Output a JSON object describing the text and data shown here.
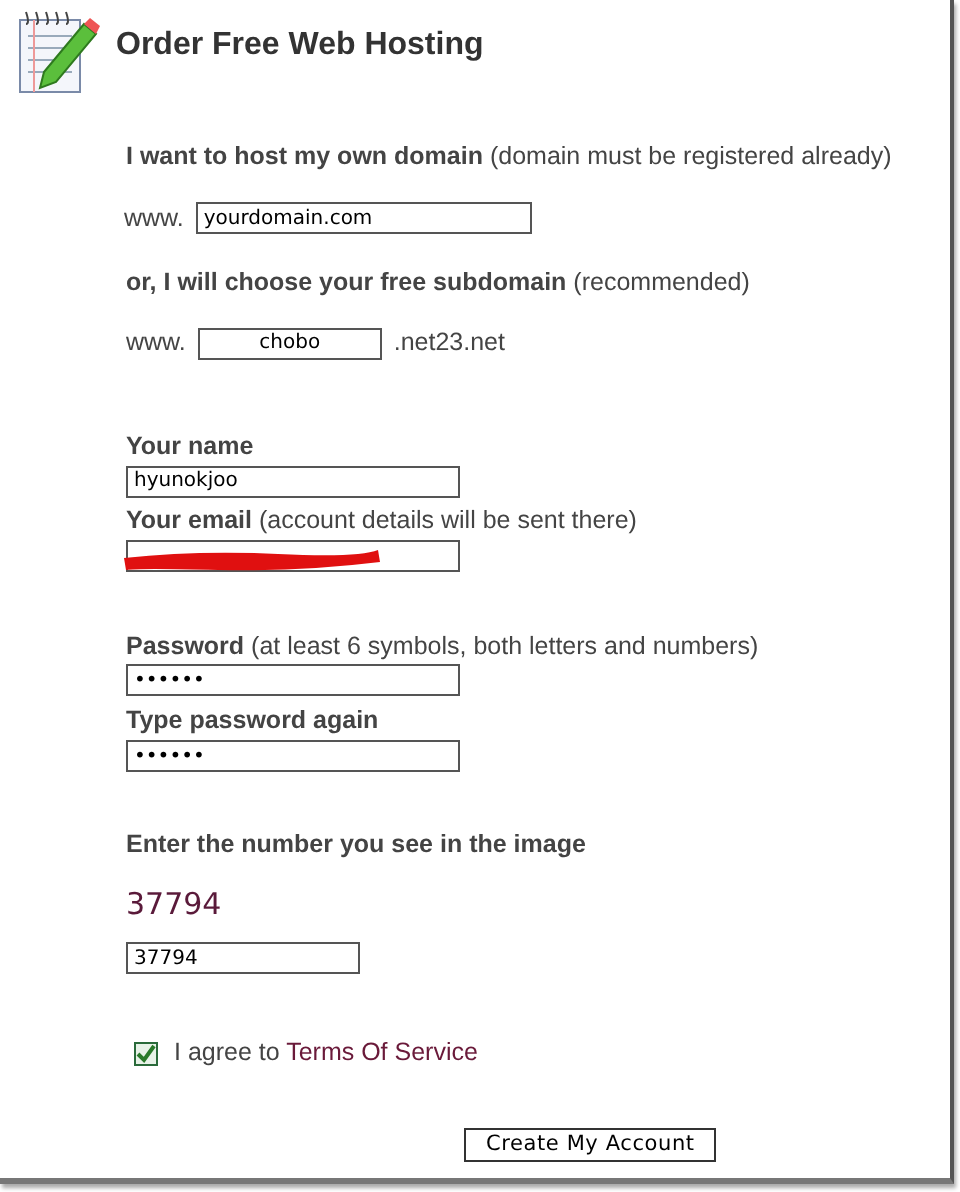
{
  "header": {
    "title": "Order Free Web Hosting"
  },
  "own_domain": {
    "label": "I want to host my own domain",
    "note": "(domain must be registered already)",
    "prefix": "www.",
    "value": "yourdomain.com"
  },
  "subdomain": {
    "label": "or, I will choose your free subdomain",
    "note": "(recommended)",
    "prefix": "www.",
    "value": "chobo",
    "suffix": ".net23.net"
  },
  "name": {
    "label": "Your name",
    "value": "hyunokjoo"
  },
  "email": {
    "label": "Your email",
    "note": "(account details will be sent there)",
    "redacted": true
  },
  "password": {
    "label": "Password",
    "note": "(at least 6 symbols, both letters and numbers)",
    "value": "••••••"
  },
  "password_again": {
    "label": "Type password again",
    "value": "••••••"
  },
  "captcha": {
    "label": "Enter the number you see in the image",
    "number": "37794",
    "value": "37794"
  },
  "agree": {
    "checked": true,
    "text": "I agree to",
    "link": "Terms Of Service"
  },
  "submit": {
    "label": "Create My Account"
  }
}
